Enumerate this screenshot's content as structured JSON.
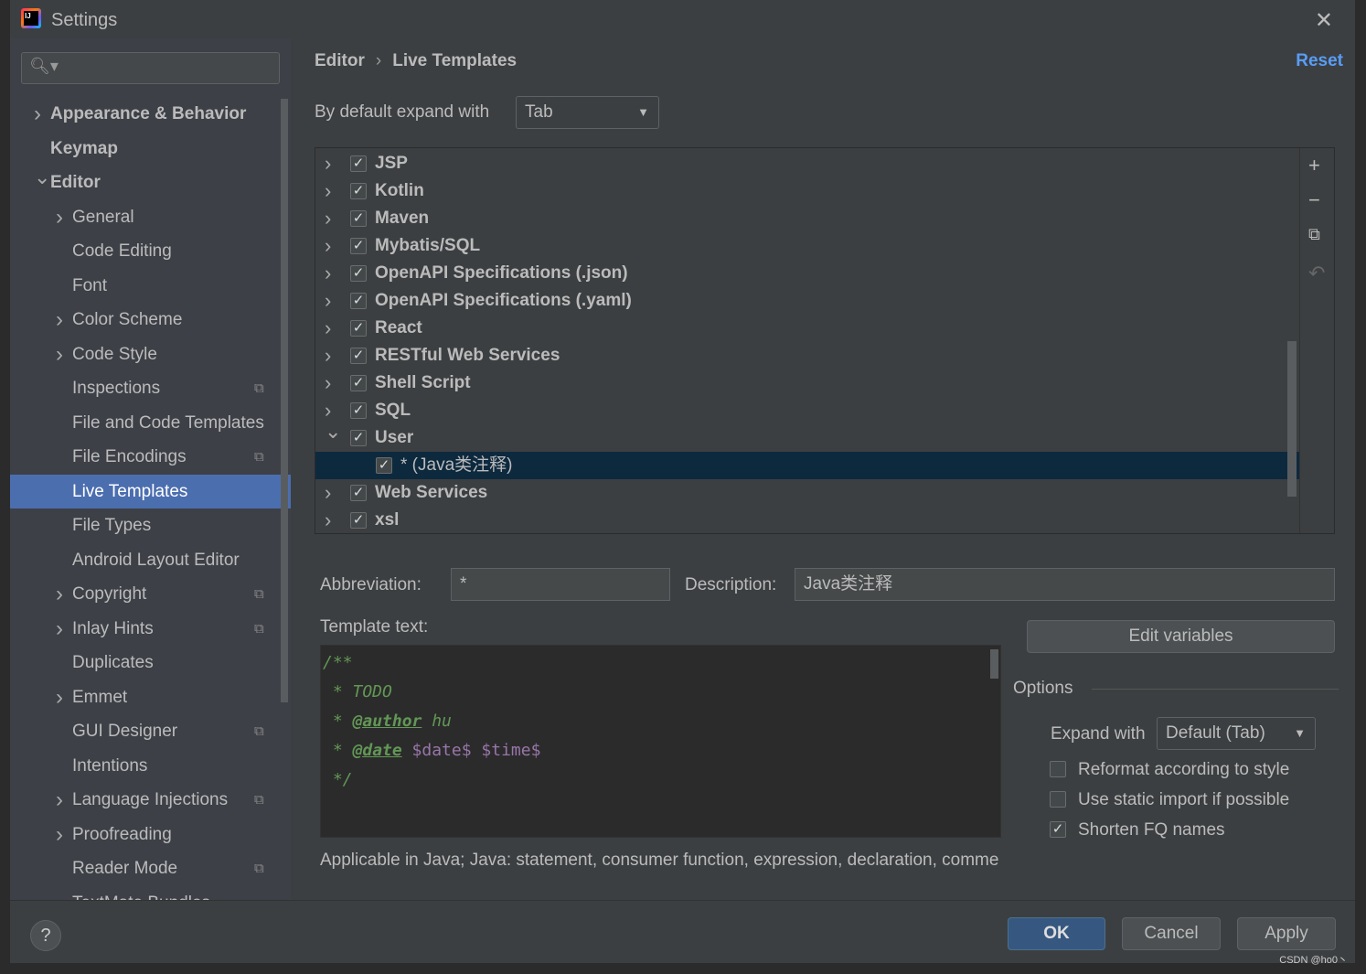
{
  "window": {
    "title": "Settings",
    "close_icon": "close-icon"
  },
  "search": {
    "placeholder": ""
  },
  "sidebar": {
    "items": [
      {
        "label": "Appearance & Behavior",
        "level": 0,
        "arrow": "right",
        "bold": true
      },
      {
        "label": "Keymap",
        "level": 0,
        "arrow": "",
        "bold": true
      },
      {
        "label": "Editor",
        "level": 0,
        "arrow": "down",
        "bold": true
      },
      {
        "label": "General",
        "level": 1,
        "arrow": "right"
      },
      {
        "label": "Code Editing",
        "level": 1,
        "arrow": ""
      },
      {
        "label": "Font",
        "level": 1,
        "arrow": ""
      },
      {
        "label": "Color Scheme",
        "level": 1,
        "arrow": "right"
      },
      {
        "label": "Code Style",
        "level": 1,
        "arrow": "right"
      },
      {
        "label": "Inspections",
        "level": 1,
        "arrow": "",
        "project": true
      },
      {
        "label": "File and Code Templates",
        "level": 1,
        "arrow": ""
      },
      {
        "label": "File Encodings",
        "level": 1,
        "arrow": "",
        "project": true
      },
      {
        "label": "Live Templates",
        "level": 1,
        "arrow": "",
        "selected": true
      },
      {
        "label": "File Types",
        "level": 1,
        "arrow": ""
      },
      {
        "label": "Android Layout Editor",
        "level": 1,
        "arrow": ""
      },
      {
        "label": "Copyright",
        "level": 1,
        "arrow": "right",
        "project": true
      },
      {
        "label": "Inlay Hints",
        "level": 1,
        "arrow": "right",
        "project": true
      },
      {
        "label": "Duplicates",
        "level": 1,
        "arrow": ""
      },
      {
        "label": "Emmet",
        "level": 1,
        "arrow": "right"
      },
      {
        "label": "GUI Designer",
        "level": 1,
        "arrow": "",
        "project": true
      },
      {
        "label": "Intentions",
        "level": 1,
        "arrow": ""
      },
      {
        "label": "Language Injections",
        "level": 1,
        "arrow": "right",
        "project": true
      },
      {
        "label": "Proofreading",
        "level": 1,
        "arrow": "right"
      },
      {
        "label": "Reader Mode",
        "level": 1,
        "arrow": "",
        "project": true
      },
      {
        "label": "TextMate Bundles",
        "level": 1,
        "arrow": ""
      }
    ]
  },
  "main": {
    "breadcrumb": [
      "Editor",
      "Live Templates"
    ],
    "reset_label": "Reset",
    "expand_label": "By default expand with",
    "expand_value": "Tab",
    "tree": [
      {
        "label": "JSP",
        "checked": true,
        "expanded": false
      },
      {
        "label": "Kotlin",
        "checked": true,
        "expanded": false
      },
      {
        "label": "Maven",
        "checked": true,
        "expanded": false
      },
      {
        "label": "Mybatis/SQL",
        "checked": true,
        "expanded": false
      },
      {
        "label": "OpenAPI Specifications (.json)",
        "checked": true,
        "expanded": false
      },
      {
        "label": "OpenAPI Specifications (.yaml)",
        "checked": true,
        "expanded": false
      },
      {
        "label": "React",
        "checked": true,
        "expanded": false
      },
      {
        "label": "RESTful Web Services",
        "checked": true,
        "expanded": false
      },
      {
        "label": "Shell Script",
        "checked": true,
        "expanded": false
      },
      {
        "label": "SQL",
        "checked": true,
        "expanded": false
      },
      {
        "label": "User",
        "checked": true,
        "expanded": true
      },
      {
        "label": "* (Java类注释)",
        "checked": true,
        "child": true,
        "selected": true
      },
      {
        "label": "Web Services",
        "checked": true,
        "expanded": false
      },
      {
        "label": "xsl",
        "checked": true,
        "expanded": false
      }
    ],
    "tree_tools": [
      "plus-icon",
      "minus-icon",
      "copy-icon",
      "undo-icon"
    ],
    "abbreviation_label": "Abbreviation:",
    "abbreviation_value": "*",
    "description_label": "Description:",
    "description_value": "Java类注释",
    "template_label": "Template text:",
    "template_lines": [
      "/**",
      " * TODO",
      " * @author hu",
      " * @date $date$ $time$",
      " */"
    ],
    "edit_variables": "Edit variables",
    "options_label": "Options",
    "expand_with_label": "Expand with",
    "expand_with_value": "Default (Tab)",
    "options": [
      {
        "label": "Reformat according to style",
        "checked": false
      },
      {
        "label": "Use static import if possible",
        "checked": false
      },
      {
        "label": "Shorten FQ names",
        "checked": true
      }
    ],
    "applicable": "Applicable in Java; Java: statement, consumer function, expression, declaration, comme"
  },
  "footer": {
    "ok": "OK",
    "cancel": "Cancel",
    "apply": "Apply",
    "help": "?"
  },
  "watermark": "CSDN @ho0丶"
}
